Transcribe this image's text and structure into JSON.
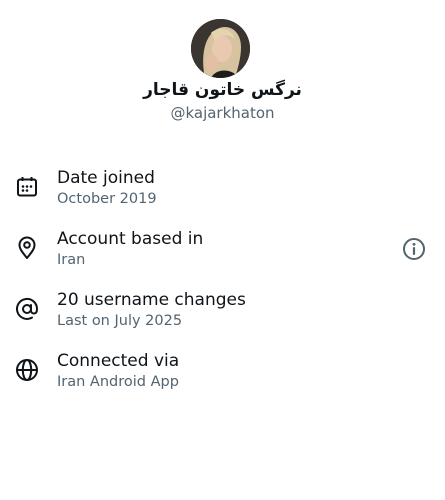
{
  "profile": {
    "display_name": "نرگس خاتون قاجار",
    "handle": "@kajarkhaton",
    "avatar": "profile-photo"
  },
  "about_rows": [
    {
      "icon": "calendar-icon",
      "title": "Date joined",
      "subtitle": "October 2019"
    },
    {
      "icon": "location-pin-icon",
      "title": "Account based in",
      "subtitle": "Iran",
      "trailing_icon": "info-icon"
    },
    {
      "icon": "at-sign-icon",
      "title": "20 username changes",
      "subtitle": "Last on July 2025"
    },
    {
      "icon": "globe-icon",
      "title": "Connected via",
      "subtitle": "Iran Android App"
    }
  ],
  "colors": {
    "primary_text": "#0f1419",
    "secondary_text": "#536471",
    "background": "#ffffff"
  }
}
